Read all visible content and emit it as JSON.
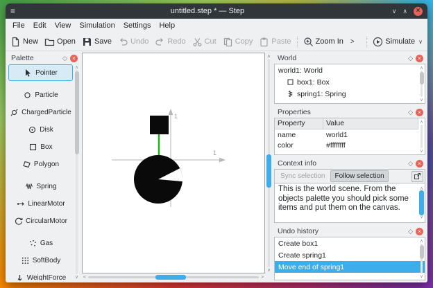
{
  "window": {
    "title": "untitled.step * — Step"
  },
  "icons": {
    "app_menu": "≡",
    "minimize": "∨",
    "maximize": "∧",
    "close": "×",
    "panel_float": "◇",
    "panel_close": "×",
    "scroll_up": "∧",
    "scroll_down": "∨",
    "scroll_left": "<",
    "scroll_right": ">",
    "toolbar_overflow": ">",
    "dropdown_caret": "∨"
  },
  "menubar": {
    "items": [
      "File",
      "Edit",
      "View",
      "Simulation",
      "Settings",
      "Help"
    ]
  },
  "toolbar": {
    "buttons": [
      {
        "label": "New"
      },
      {
        "label": "Open"
      },
      {
        "label": "Save"
      },
      {
        "label": "Undo"
      },
      {
        "label": "Redo"
      },
      {
        "label": "Cut"
      },
      {
        "label": "Copy"
      },
      {
        "label": "Paste"
      },
      {
        "label": "Zoom In"
      },
      {
        "label": "Simulate"
      }
    ]
  },
  "palette": {
    "title": "Palette",
    "selected": "Pointer",
    "items": [
      {
        "label": "Pointer"
      },
      {
        "label": "Particle"
      },
      {
        "label": "ChargedParticle"
      },
      {
        "label": "Disk"
      },
      {
        "label": "Box"
      },
      {
        "label": "Polygon"
      },
      {
        "label": "Spring"
      },
      {
        "label": "LinearMotor"
      },
      {
        "label": "CircularMotor"
      },
      {
        "label": "Gas"
      },
      {
        "label": "SoftBody"
      },
      {
        "label": "WeightForce"
      }
    ]
  },
  "canvas": {
    "x_axis_label": "1",
    "y_axis_label": "1"
  },
  "world_panel": {
    "title": "World",
    "items": [
      {
        "label": "world1: World"
      },
      {
        "label": "box1: Box"
      },
      {
        "label": "spring1: Spring"
      }
    ]
  },
  "properties_panel": {
    "title": "Properties",
    "columns": [
      "Property",
      "Value"
    ],
    "rows": [
      {
        "property": "name",
        "value": "world1"
      },
      {
        "property": "color",
        "value": "#ffffffff"
      }
    ]
  },
  "context_panel": {
    "title": "Context info",
    "sync_button": "Sync selection",
    "follow_button": "Follow selection",
    "text": "This is the world scene. From the objects palette you should pick some items and put them on the canvas."
  },
  "undo_panel": {
    "title": "Undo history",
    "items": [
      {
        "label": "Create box1"
      },
      {
        "label": "Create spring1"
      },
      {
        "label": "Move end of spring1",
        "selected": true
      }
    ]
  },
  "colors": {
    "accent": "#3daee9",
    "titlebar": "#31363b",
    "close_red": "#e8635a",
    "spring_green": "#1db21d",
    "selection_blue": "#3daee9",
    "canvas_bg": "#ffffff"
  }
}
